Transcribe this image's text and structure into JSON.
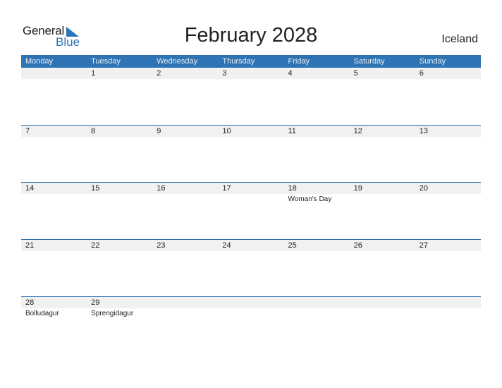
{
  "logo": {
    "line1": "General",
    "line2": "Blue"
  },
  "title": "February 2028",
  "country": "Iceland",
  "colors": {
    "header_bg": "#2e73b3",
    "row_bg": "#f1f1f1",
    "accent": "#2a74b5"
  },
  "weekdays": [
    "Monday",
    "Tuesday",
    "Wednesday",
    "Thursday",
    "Friday",
    "Saturday",
    "Sunday"
  ],
  "weeks": [
    [
      {
        "d": ""
      },
      {
        "d": "1"
      },
      {
        "d": "2"
      },
      {
        "d": "3"
      },
      {
        "d": "4"
      },
      {
        "d": "5"
      },
      {
        "d": "6"
      }
    ],
    [
      {
        "d": "7"
      },
      {
        "d": "8"
      },
      {
        "d": "9"
      },
      {
        "d": "10"
      },
      {
        "d": "11"
      },
      {
        "d": "12"
      },
      {
        "d": "13"
      }
    ],
    [
      {
        "d": "14"
      },
      {
        "d": "15"
      },
      {
        "d": "16"
      },
      {
        "d": "17"
      },
      {
        "d": "18",
        "h": "Woman's Day"
      },
      {
        "d": "19"
      },
      {
        "d": "20"
      }
    ],
    [
      {
        "d": "21"
      },
      {
        "d": "22"
      },
      {
        "d": "23"
      },
      {
        "d": "24"
      },
      {
        "d": "25"
      },
      {
        "d": "26"
      },
      {
        "d": "27"
      }
    ],
    [
      {
        "d": "28",
        "h": "Bolludagur"
      },
      {
        "d": "29",
        "h": "Sprengidagur"
      },
      {
        "d": ""
      },
      {
        "d": ""
      },
      {
        "d": ""
      },
      {
        "d": ""
      },
      {
        "d": ""
      }
    ]
  ]
}
